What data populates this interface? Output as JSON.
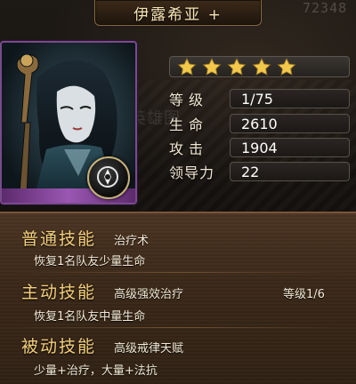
{
  "hero": {
    "name": "伊露希亚 +",
    "top_right_number": "72348",
    "ghost_label": "英雄图"
  },
  "stars": {
    "count": 5,
    "max": 5,
    "color": "#f2c94c"
  },
  "stats": {
    "level_label": "等级",
    "level_value": "1/75",
    "hp_label": "生命",
    "hp_value": "2610",
    "atk_label": "攻击",
    "atk_value": "1904",
    "leadership_label": "领导力",
    "leadership_value": "22"
  },
  "skills": {
    "normal": {
      "title": "普通技能",
      "name": "治疗术",
      "desc": "恢复1名队友少量生命"
    },
    "active": {
      "title": "主动技能",
      "name": "高级强效治疗",
      "level": "等级1/6",
      "desc": "恢复1名队友中量生命"
    },
    "passive": {
      "title": "被动技能",
      "name": "高级戒律天赋",
      "desc": "少量+治疗，大量+法抗"
    }
  },
  "colors": {
    "accent_gold": "#f3cf7a",
    "frame_purple": "#7a4a8e"
  }
}
